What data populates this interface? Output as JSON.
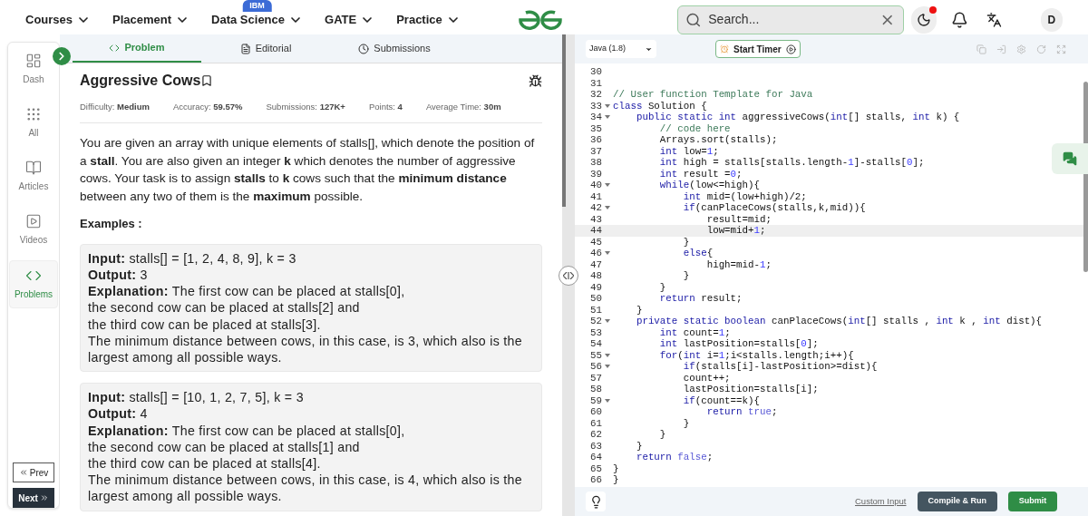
{
  "nav": {
    "items": [
      {
        "label": "Courses"
      },
      {
        "label": "Placement"
      },
      {
        "label": "Data Science",
        "badge": "IBM"
      },
      {
        "label": "GATE"
      },
      {
        "label": "Practice"
      }
    ],
    "search": {
      "placeholder": "Search..."
    },
    "notification_dot": true,
    "avatar": "D"
  },
  "sidebar": {
    "items": [
      {
        "label": "Dash",
        "selected": false
      },
      {
        "label": "All",
        "selected": false
      },
      {
        "label": "Articles",
        "selected": false
      },
      {
        "label": "Videos",
        "selected": false
      },
      {
        "label": "Problems",
        "selected": true
      }
    ],
    "prev": "Prev",
    "next": "Next"
  },
  "tabs": [
    {
      "label": "Problem",
      "selected": true
    },
    {
      "label": "Editorial",
      "selected": false
    },
    {
      "label": "Submissions",
      "selected": false
    }
  ],
  "problem": {
    "title": "Aggressive Cows",
    "meta": [
      {
        "label": "Difficulty:",
        "value": "Medium"
      },
      {
        "label": "Accuracy:",
        "value": "59.57%"
      },
      {
        "label": "Submissions:",
        "value": "127K+"
      },
      {
        "label": "Points:",
        "value": "4"
      },
      {
        "label": "Average Time:",
        "value": "30m"
      }
    ],
    "description": "You are given an array with unique elements of stalls[], which denote the position of a **stall**. You are also given an integer **k** which denotes the number of aggressive cows. Your task is to assign **stalls** to **k** cows such that the **minimum distance** between any two of them is the **maximum** possible.",
    "examples_heading": "Examples :",
    "examples": [
      {
        "input_label": "Input:",
        "input": "stalls[] = [1, 2, 4, 8, 9], k = 3",
        "output_label": "Output:",
        "output": "3",
        "explanation_label": "Explanation:",
        "explanation": [
          "The first cow can be placed at stalls[0],",
          "the second cow can be placed at stalls[2] and",
          "the third cow can be placed at stalls[3].",
          "The minimum distance between cows, in this case, is 3, which also is the largest among all possible ways."
        ]
      },
      {
        "input_label": "Input:",
        "input": "stalls[] = [10, 1, 2, 7, 5], k = 3",
        "output_label": "Output:",
        "output": "4",
        "explanation_label": "Explanation:",
        "explanation": [
          "The first cow can be placed at stalls[0],",
          "the second cow can be placed at stalls[1] and",
          "the third cow can be placed at stalls[4].",
          "The minimum distance between cows, in this case, is 4, which also is the largest among all possible ways."
        ]
      }
    ]
  },
  "editor": {
    "language": "Java (1.8)",
    "timer": "Start Timer",
    "lines": [
      {
        "number": "30",
        "foldable": false,
        "current": false
      },
      {
        "number": "31",
        "foldable": false,
        "current": false
      },
      {
        "number": "32",
        "foldable": false,
        "current": false,
        "segments": [
          {
            "kind": "comment",
            "text": "// User function Template for Java"
          }
        ]
      },
      {
        "number": "33",
        "foldable": true,
        "current": false,
        "segments": [
          {
            "kind": "keyword",
            "text": "class"
          },
          {
            "kind": "plain",
            "text": " Solution {"
          }
        ]
      },
      {
        "number": "34",
        "foldable": true,
        "current": false,
        "segments": [
          {
            "kind": "keyword",
            "text": "    public static int"
          },
          {
            "kind": "plain",
            "text": " aggressiveCows("
          },
          {
            "kind": "keyword",
            "text": "int"
          },
          {
            "kind": "plain",
            "text": "[] stalls, "
          },
          {
            "kind": "keyword",
            "text": "int"
          },
          {
            "kind": "plain",
            "text": " k) {"
          }
        ]
      },
      {
        "number": "35",
        "foldable": false,
        "current": false,
        "segments": [
          {
            "kind": "comment",
            "text": "        // code here"
          }
        ]
      },
      {
        "number": "36",
        "foldable": false,
        "current": false,
        "segments": [
          {
            "kind": "plain",
            "text": "        Arrays.sort(stalls);"
          }
        ]
      },
      {
        "number": "37",
        "foldable": false,
        "current": false,
        "segments": [
          {
            "kind": "keyword",
            "text": "        int"
          },
          {
            "kind": "plain",
            "text": " low="
          },
          {
            "kind": "number",
            "text": "1"
          },
          {
            "kind": "plain",
            "text": ";"
          }
        ]
      },
      {
        "number": "38",
        "foldable": false,
        "current": false,
        "segments": [
          {
            "kind": "keyword",
            "text": "        int"
          },
          {
            "kind": "plain",
            "text": " high = stalls[stalls.length-"
          },
          {
            "kind": "number",
            "text": "1"
          },
          {
            "kind": "plain",
            "text": "]-stalls["
          },
          {
            "kind": "number",
            "text": "0"
          },
          {
            "kind": "plain",
            "text": "];"
          }
        ]
      },
      {
        "number": "39",
        "foldable": false,
        "current": false,
        "segments": [
          {
            "kind": "keyword",
            "text": "        int"
          },
          {
            "kind": "plain",
            "text": " result ="
          },
          {
            "kind": "number",
            "text": "0"
          },
          {
            "kind": "plain",
            "text": ";"
          }
        ]
      },
      {
        "number": "40",
        "foldable": true,
        "current": false,
        "segments": [
          {
            "kind": "keyword",
            "text": "        while"
          },
          {
            "kind": "plain",
            "text": "(low<=high){"
          }
        ]
      },
      {
        "number": "41",
        "foldable": false,
        "current": false,
        "segments": [
          {
            "kind": "keyword",
            "text": "            int"
          },
          {
            "kind": "plain",
            "text": " mid=(low+high)/2;"
          }
        ]
      },
      {
        "number": "42",
        "foldable": true,
        "current": false,
        "segments": [
          {
            "kind": "keyword",
            "text": "            if"
          },
          {
            "kind": "plain",
            "text": "(canPlaceCows(stalls,k,mid)){"
          }
        ]
      },
      {
        "number": "43",
        "foldable": false,
        "current": false,
        "segments": [
          {
            "kind": "plain",
            "text": "                result=mid;"
          }
        ]
      },
      {
        "number": "44",
        "foldable": false,
        "current": true,
        "segments": [
          {
            "kind": "plain",
            "text": "                low=mid+"
          },
          {
            "kind": "number",
            "text": "1"
          },
          {
            "kind": "plain",
            "text": ";"
          }
        ]
      },
      {
        "number": "45",
        "foldable": false,
        "current": false,
        "segments": [
          {
            "kind": "plain",
            "text": "            }"
          }
        ]
      },
      {
        "number": "46",
        "foldable": true,
        "current": false,
        "segments": [
          {
            "kind": "keyword",
            "text": "            else"
          },
          {
            "kind": "plain",
            "text": "{"
          }
        ]
      },
      {
        "number": "47",
        "foldable": false,
        "current": false,
        "segments": [
          {
            "kind": "plain",
            "text": "                high=mid-"
          },
          {
            "kind": "number",
            "text": "1"
          },
          {
            "kind": "plain",
            "text": ";"
          }
        ]
      },
      {
        "number": "48",
        "foldable": false,
        "current": false,
        "segments": [
          {
            "kind": "plain",
            "text": "            }"
          }
        ]
      },
      {
        "number": "49",
        "foldable": false,
        "current": false,
        "segments": [
          {
            "kind": "plain",
            "text": "        }"
          }
        ]
      },
      {
        "number": "50",
        "foldable": false,
        "current": false,
        "segments": [
          {
            "kind": "keyword",
            "text": "        return"
          },
          {
            "kind": "plain",
            "text": " result;"
          }
        ]
      },
      {
        "number": "51",
        "foldable": false,
        "current": false,
        "segments": [
          {
            "kind": "plain",
            "text": "    }"
          }
        ]
      },
      {
        "number": "52",
        "foldable": true,
        "current": false,
        "segments": [
          {
            "kind": "keyword",
            "text": "    private static boolean"
          },
          {
            "kind": "plain",
            "text": " canPlaceCows("
          },
          {
            "kind": "keyword",
            "text": "int"
          },
          {
            "kind": "plain",
            "text": "[] stalls , "
          },
          {
            "kind": "keyword",
            "text": "int"
          },
          {
            "kind": "plain",
            "text": " k , "
          },
          {
            "kind": "keyword",
            "text": "int"
          },
          {
            "kind": "plain",
            "text": " dist){"
          }
        ]
      },
      {
        "number": "53",
        "foldable": false,
        "current": false,
        "segments": [
          {
            "kind": "keyword",
            "text": "        int"
          },
          {
            "kind": "plain",
            "text": " count="
          },
          {
            "kind": "number",
            "text": "1"
          },
          {
            "kind": "plain",
            "text": ";"
          }
        ]
      },
      {
        "number": "54",
        "foldable": false,
        "current": false,
        "segments": [
          {
            "kind": "keyword",
            "text": "        int"
          },
          {
            "kind": "plain",
            "text": " lastPosition=stalls["
          },
          {
            "kind": "number",
            "text": "0"
          },
          {
            "kind": "plain",
            "text": "];"
          }
        ]
      },
      {
        "number": "55",
        "foldable": true,
        "current": false,
        "segments": [
          {
            "kind": "keyword",
            "text": "        for"
          },
          {
            "kind": "plain",
            "text": "("
          },
          {
            "kind": "keyword",
            "text": "int"
          },
          {
            "kind": "plain",
            "text": " i="
          },
          {
            "kind": "number",
            "text": "1"
          },
          {
            "kind": "plain",
            "text": ";i<stalls.length;i++){"
          }
        ]
      },
      {
        "number": "56",
        "foldable": true,
        "current": false,
        "segments": [
          {
            "kind": "keyword",
            "text": "            if"
          },
          {
            "kind": "plain",
            "text": "(stalls[i]-lastPosition>=dist){"
          }
        ]
      },
      {
        "number": "57",
        "foldable": false,
        "current": false,
        "segments": [
          {
            "kind": "plain",
            "text": "            count++;"
          }
        ]
      },
      {
        "number": "58",
        "foldable": false,
        "current": false,
        "segments": [
          {
            "kind": "plain",
            "text": "            lastPosition=stalls[i];"
          }
        ]
      },
      {
        "number": "59",
        "foldable": true,
        "current": false,
        "segments": [
          {
            "kind": "keyword",
            "text": "            if"
          },
          {
            "kind": "plain",
            "text": "(count==k){"
          }
        ]
      },
      {
        "number": "60",
        "foldable": false,
        "current": false,
        "segments": [
          {
            "kind": "keyword",
            "text": "                return"
          },
          {
            "kind": "literal",
            "text": " true"
          },
          {
            "kind": "plain",
            "text": ";"
          }
        ]
      },
      {
        "number": "61",
        "foldable": false,
        "current": false,
        "segments": [
          {
            "kind": "plain",
            "text": "            }"
          }
        ]
      },
      {
        "number": "62",
        "foldable": false,
        "current": false,
        "segments": [
          {
            "kind": "plain",
            "text": "        }"
          }
        ]
      },
      {
        "number": "63",
        "foldable": false,
        "current": false,
        "segments": [
          {
            "kind": "plain",
            "text": "    }"
          }
        ]
      },
      {
        "number": "64",
        "foldable": false,
        "current": false,
        "segments": [
          {
            "kind": "keyword",
            "text": "    return"
          },
          {
            "kind": "literal",
            "text": " false"
          },
          {
            "kind": "plain",
            "text": ";"
          }
        ]
      },
      {
        "number": "65",
        "foldable": false,
        "current": false,
        "segments": [
          {
            "kind": "plain",
            "text": "}"
          }
        ]
      },
      {
        "number": "66",
        "foldable": false,
        "current": false,
        "segments": [
          {
            "kind": "plain",
            "text": "}"
          }
        ]
      }
    ],
    "custom_input": "Custom Input",
    "compile": "Compile & Run",
    "submit": "Submit"
  }
}
